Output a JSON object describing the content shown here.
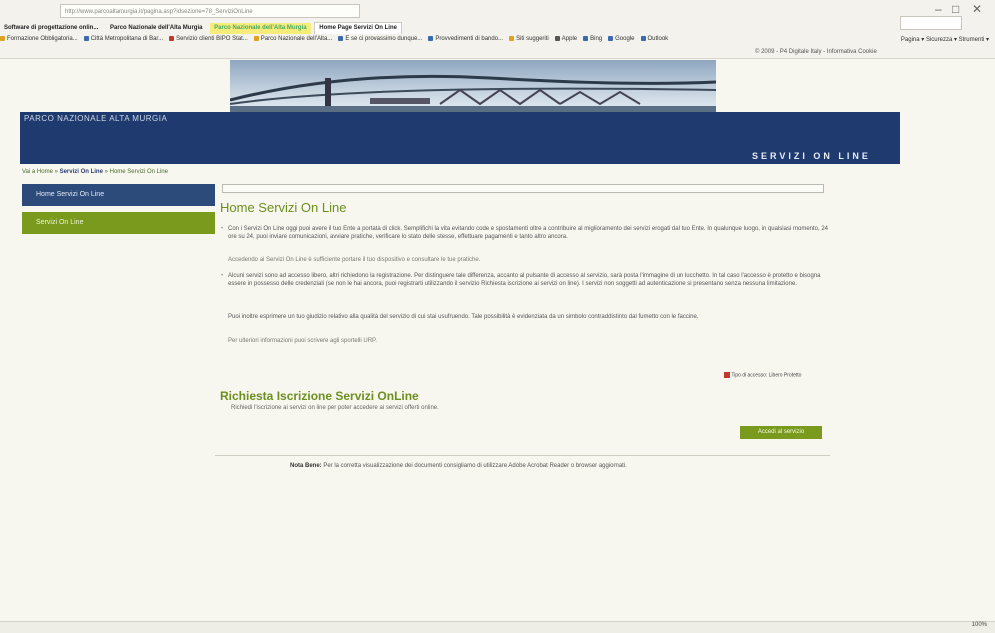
{
  "browser": {
    "address": "http://www.parcoaltamurgia.it/pagina.asp?idsezione=78_ServiziOnLine",
    "search_placeholder": "",
    "tabs": [
      {
        "label": "Software di progettazione onlin...",
        "state": "normal"
      },
      {
        "label": "Parco Nazionale dell'Alta Murgia",
        "state": "normal"
      },
      {
        "label": "Parco Nazionale dell'Alta Murgia",
        "state": "highlight"
      },
      {
        "label": "Home Page Servizi On Line",
        "state": "active"
      }
    ],
    "favorites": [
      {
        "label": "Formazione Obbligatoria...",
        "color": "#e0a020"
      },
      {
        "label": "Città Metropolitana di Bar...",
        "color": "#3a6ab0"
      },
      {
        "label": "Servizio clienti BIPO Stat...",
        "color": "#c0392b"
      },
      {
        "label": "Parco Nazionale dell'Alta...",
        "color": "#e0a020"
      },
      {
        "label": "E se ci provassimo dunque...",
        "color": "#3a6ab0"
      },
      {
        "label": "Provvedimenti di bando...",
        "color": "#3a6ab0"
      },
      {
        "label": "Siti suggeriti",
        "color": "#e0a020"
      },
      {
        "label": "Apple",
        "color": "#555555"
      },
      {
        "label": "Bing",
        "color": "#3a6ab0"
      },
      {
        "label": "Google",
        "color": "#3a6ab0"
      },
      {
        "label": "Outlook",
        "color": "#3a6ab0"
      }
    ],
    "commands": "Pagina ▾  Sicurezza ▾  Strumenti ▾",
    "zoom": "100%"
  },
  "site": {
    "copyright": "© 2009 - P4 Digitale Italy - Informativa Cookie",
    "park_name": "PARCO NAZIONALE ALTA MURGIA",
    "banner_title": "SERVIZI ON LINE",
    "breadcrumb": {
      "home": "Vai a Home",
      "section": "Servizi On Line",
      "current": "Home Servizi On Line"
    }
  },
  "sidebar": {
    "items": [
      {
        "label": "Home Servizi On Line"
      },
      {
        "label": "Servizi On Line"
      }
    ]
  },
  "main": {
    "title": "Home Servizi On Line",
    "paragraphs": [
      "Con i Servizi On Line oggi puoi avere il tuo Ente a portata di click. Semplifichi la vita evitando code e spostamenti oltre a contribuire al miglioramento dei servizi erogati dal tuo Ente. In qualunque luogo, in qualsiasi momento, 24 ore su 24, puoi inviare comunicazioni, avviare pratiche, verificare lo stato delle stesse, effettuare pagamenti e tanto altro ancora.",
      "Accedendo ai Servizi On Line è sufficiente portare il tuo dispositivo e consultare le tue pratiche.",
      "Alcuni servizi sono ad accesso libero, altri richiedono la registrazione. Per distinguere tale differenza, accanto al pulsante di accesso al servizio, sarà posta l'immagine di un lucchetto. In tal caso l'accesso è protetto e bisogna essere in possesso delle credenziali (se non le hai ancora, puoi registrarti utilizzando il servizio Richiesta iscrizione ai servizi on line). I servizi non soggetti ad autenticazione si presentano senza nessuna limitazione.",
      "Puoi inoltre esprimere un tuo giudizio relativo alla qualità del servizio di cui stai usufruendo. Tale possibilità è evidenziata da un simbolo contraddistinto dal fumetto con le faccine.",
      "Per ulteriori informazioni puoi scrivere agli sportelli URP."
    ],
    "legend": "Tipo di accesso:  Libero  Protetto",
    "section2_title": "Richiesta Iscrizione Servizi OnLine",
    "section2_text": "Richiedi l'iscrizione ai servizi on line per poter accedere ai servizi offerti online.",
    "access_button": "Accedi al servizio",
    "note_label": "Nota Bene:",
    "note_text": "Per la corretta visualizzazione dei documenti consigliamo di utilizzare Adobe Acrobat Reader o browser aggiornati."
  }
}
